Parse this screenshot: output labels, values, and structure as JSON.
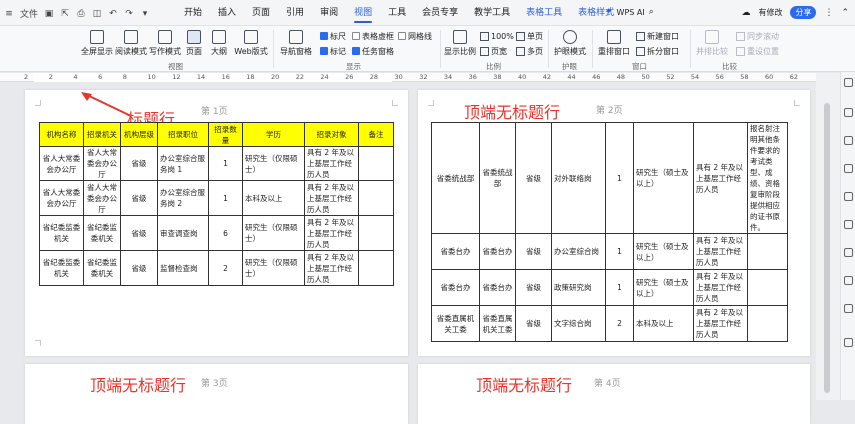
{
  "titlebar": {
    "file_label": "文件",
    "menus": [
      "开始",
      "插入",
      "页面",
      "引用",
      "审阅",
      "视图",
      "工具",
      "会员专享",
      "教学工具",
      "表格工具",
      "表格样式"
    ],
    "active_menu": "视图",
    "wps_ai": "WPS AI",
    "edit_status": "有修改",
    "share": "分享"
  },
  "ribbon": {
    "buttons": [
      "全屏显示",
      "阅读模式",
      "写作模式",
      "页面",
      "大纲",
      "Web版式"
    ],
    "nav_pane": "导航窗格",
    "checks": [
      {
        "label": "标尺",
        "on": true
      },
      {
        "label": "表格虚框",
        "on": false
      },
      {
        "label": "网格线",
        "on": false
      },
      {
        "label": "标记",
        "on": true
      },
      {
        "label": "任务窗格",
        "on": true
      }
    ],
    "zoom_btns": [
      "显示比例",
      "100%",
      "页宽",
      "单页",
      "多页"
    ],
    "eye_mode": "护眼模式",
    "window_btns": [
      "重排窗口",
      "新建窗口",
      "拆分窗口"
    ],
    "compare_btns": [
      "并排比较",
      "同步滚动",
      "重设位置"
    ],
    "groups": [
      "视图",
      "显示",
      "比例",
      "护眼",
      "窗口",
      "比较"
    ]
  },
  "ruler_numbers": [
    "2",
    "2",
    "4",
    "6",
    "8",
    "10",
    "12",
    "14",
    "16",
    "18",
    "20",
    "22",
    "24",
    "26",
    "28",
    "30",
    "32",
    "34",
    "36",
    "38",
    "40",
    "42",
    "44",
    "46",
    "48",
    "50",
    "52",
    "54",
    "56",
    "58",
    "60",
    "62"
  ],
  "page1": {
    "title": "标题行",
    "page_num": "第 1页",
    "headers": [
      "机构名称",
      "招录机关",
      "机构层级",
      "招录职位",
      "招录数量",
      "学历",
      "招录对象",
      "备注"
    ],
    "rows": [
      [
        "省人大常委会办公厅",
        "省人大常委会办公厅",
        "省级",
        "办公室综合服务岗 1",
        "1",
        "研究生（仅限硕士）",
        "具有 2 年及以上基层工作经历人员",
        ""
      ],
      [
        "省人大常委会办公厅",
        "省人大常委会办公厅",
        "省级",
        "办公室综合服务岗 2",
        "1",
        "本科及以上",
        "具有 2 年及以上基层工作经历人员",
        ""
      ],
      [
        "省纪委监委机关",
        "省纪委监委机关",
        "省级",
        "审查调查岗",
        "6",
        "研究生（仅限硕士）",
        "具有 2 年及以上基层工作经历人员",
        ""
      ],
      [
        "省纪委监委机关",
        "省纪委监委机关",
        "省级",
        "监督检查岗",
        "2",
        "研究生（仅限硕士）",
        "具有 2 年及以上基层工作经历人员",
        ""
      ]
    ]
  },
  "page2": {
    "title": "顶端无标题行",
    "page_num": "第 2页",
    "rows": [
      [
        "省委统战部",
        "省委统战部",
        "省级",
        "对外联络岗",
        "1",
        "研究生（硕士及以上）",
        "具有 2 年及以上基层工作经历人员",
        "报名射注明其他条件要求的考试类型、成绩、资格复审阶段提供相应的证书原件。"
      ],
      [
        "省委台办",
        "省委台办",
        "省级",
        "办公室综合岗",
        "1",
        "研究生（硕士及以上）",
        "具有 2 年及以上基层工作经历人员",
        ""
      ],
      [
        "省委台办",
        "省委台办",
        "省级",
        "政策研究岗",
        "1",
        "研究生（硕士及以上）",
        "具有 2 年及以上基层工作经历人员",
        ""
      ],
      [
        "省委直属机关工委",
        "省委直属机关工委",
        "省级",
        "文字综合岗",
        "2",
        "本科及以上",
        "具有 2 年及以上基层工作经历人员",
        ""
      ]
    ]
  },
  "page3": {
    "title": "顶端无标题行",
    "page_num": "第 3页"
  },
  "page4": {
    "title": "顶端无标题行",
    "page_num": "第 4页"
  },
  "colors": {
    "accent": "#2b5fd9",
    "header_yellow": "#ffff00",
    "title_red": "#e8352a"
  }
}
